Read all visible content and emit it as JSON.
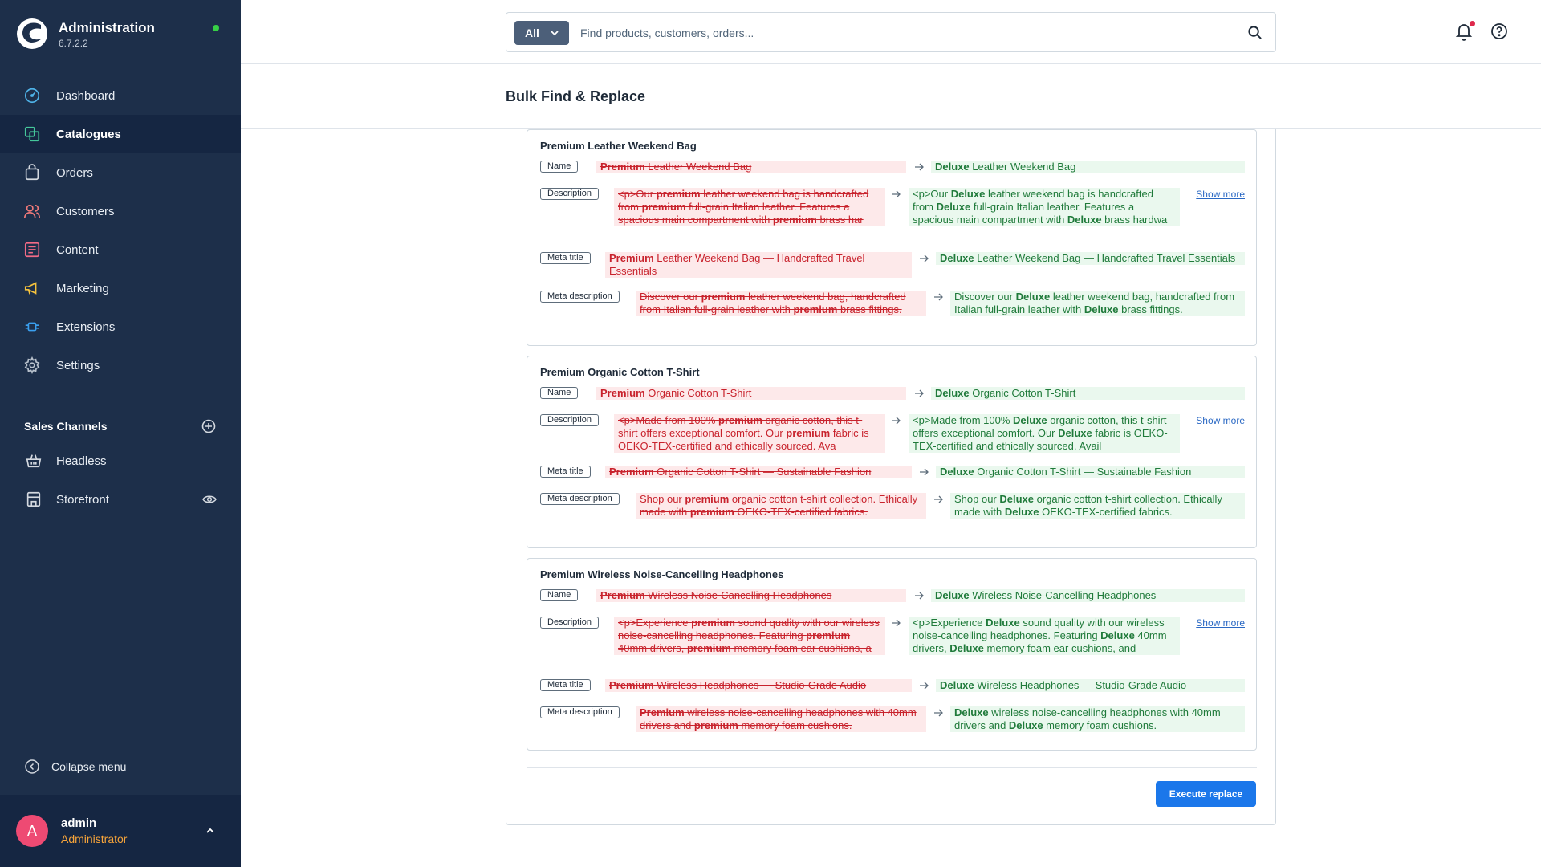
{
  "app": {
    "title": "Administration",
    "version": "6.7.2.2"
  },
  "sidebar": {
    "items": [
      {
        "label": "Dashboard"
      },
      {
        "label": "Catalogues"
      },
      {
        "label": "Orders"
      },
      {
        "label": "Customers"
      },
      {
        "label": "Content"
      },
      {
        "label": "Marketing"
      },
      {
        "label": "Extensions"
      },
      {
        "label": "Settings"
      }
    ],
    "sales_channels_title": "Sales Channels",
    "sales_channels": [
      {
        "label": "Headless"
      },
      {
        "label": "Storefront"
      }
    ],
    "collapse_label": "Collapse menu",
    "user": {
      "initial": "A",
      "name": "admin",
      "role": "Administrator"
    }
  },
  "search": {
    "filter": "All",
    "placeholder": "Find products, customers, orders..."
  },
  "page": {
    "title": "Bulk Find & Replace"
  },
  "groups": [
    {
      "title": "Premium Leather Weekend Bag",
      "rows": [
        {
          "tag": "Name",
          "old_b1": "Premium",
          "old_t1": " Leather Weekend Bag",
          "new_b1": "Deluxe",
          "new_t1": " Leather Weekend Bag"
        },
        {
          "tag": "Description",
          "old_t0": "<p>Our ",
          "old_b1": "premium",
          "old_t1": " leather weekend bag is handcrafted from ",
          "old_b2": "premium",
          "old_t2": " full-grain Italian leather. Features a spacious main compartment with ",
          "old_b3": "premium",
          "old_t3": " brass har",
          "new_t0": "<p>Our ",
          "new_b1": "Deluxe",
          "new_t1": " leather weekend bag is handcrafted from ",
          "new_b2": "Deluxe",
          "new_t2": " full-grain Italian leather. Features a spacious main compartment with ",
          "new_b3": "Deluxe",
          "new_t3": " brass hardwa",
          "show_more": "Show more"
        },
        {
          "tag": "Meta title",
          "old_b1": "Premium",
          "old_t1": " Leather Weekend Bag — Handcrafted Travel Essentials",
          "new_b1": "Deluxe",
          "new_t1": " Leather Weekend Bag — Handcrafted Travel Essentials"
        },
        {
          "tag": "Meta description",
          "old_t0": "Discover our ",
          "old_b1": "premium",
          "old_t1": " leather weekend bag, handcrafted from Italian full-grain leather with ",
          "old_b2": "premium",
          "old_t2": " brass fittings.",
          "new_t0": "Discover our ",
          "new_b1": "Deluxe",
          "new_t1": " leather weekend bag, handcrafted from Italian full-grain leather with ",
          "new_b2": "Deluxe",
          "new_t2": " brass fittings."
        }
      ]
    },
    {
      "title": "Premium Organic Cotton T-Shirt",
      "rows": [
        {
          "tag": "Name",
          "old_b1": "Premium",
          "old_t1": " Organic Cotton T-Shirt",
          "new_b1": "Deluxe",
          "new_t1": " Organic Cotton T-Shirt"
        },
        {
          "tag": "Description",
          "old_t0": "<p>Made from 100% ",
          "old_b1": "premium",
          "old_t1": " organic cotton, this t-shirt offers exceptional comfort. Our ",
          "old_b2": "premium",
          "old_t2": " fabric is OEKO-TEX-certified and ethically sourced. Ava",
          "new_t0": "<p>Made from 100% ",
          "new_b1": "Deluxe",
          "new_t1": " organic cotton, this t-shirt offers exceptional comfort. Our ",
          "new_b2": "Deluxe",
          "new_t2": " fabric is OEKO-TEX-certified and ethically sourced. Avail",
          "show_more": "Show more"
        },
        {
          "tag": "Meta title",
          "old_b1": "Premium",
          "old_t1": " Organic Cotton T-Shirt — Sustainable Fashion",
          "new_b1": "Deluxe",
          "new_t1": " Organic Cotton T-Shirt — Sustainable Fashion"
        },
        {
          "tag": "Meta description",
          "old_t0": "Shop our ",
          "old_b1": "premium",
          "old_t1": " organic cotton t-shirt collection. Ethically made with ",
          "old_b2": "premium",
          "old_t2": " OEKO-TEX-certified fabrics.",
          "new_t0": "Shop our ",
          "new_b1": "Deluxe",
          "new_t1": " organic cotton t-shirt collection. Ethically made with ",
          "new_b2": "Deluxe",
          "new_t2": " OEKO-TEX-certified fabrics."
        }
      ]
    },
    {
      "title": "Premium Wireless Noise-Cancelling Headphones",
      "rows": [
        {
          "tag": "Name",
          "old_b1": "Premium",
          "old_t1": " Wireless Noise-Cancelling Headphones",
          "new_b1": "Deluxe",
          "new_t1": " Wireless Noise-Cancelling Headphones"
        },
        {
          "tag": "Description",
          "old_t0": "<p>Experience ",
          "old_b1": "premium",
          "old_t1": " sound quality with our wireless noise-cancelling headphones. Featuring ",
          "old_b2": "premium",
          "old_t2": " 40mm drivers, ",
          "old_b3": "premium",
          "old_t3": " memory foam ear cushions, a",
          "new_t0": "<p>Experience ",
          "new_b1": "Deluxe",
          "new_t1": " sound quality with our wireless noise-cancelling headphones. Featuring ",
          "new_b2": "Deluxe",
          "new_t2": " 40mm drivers, ",
          "new_b3": "Deluxe",
          "new_t3": " memory foam ear cushions, and",
          "show_more": "Show more"
        },
        {
          "tag": "Meta title",
          "old_b1": "Premium",
          "old_t1": " Wireless Headphones — Studio-Grade Audio",
          "new_b1": "Deluxe",
          "new_t1": " Wireless Headphones — Studio-Grade Audio"
        },
        {
          "tag": "Meta description",
          "old_b1": "Premium",
          "old_t1": " wireless noise-cancelling headphones with 40mm drivers and ",
          "old_b2": "premium",
          "old_t2": " memory foam cushions.",
          "new_b1": "Deluxe",
          "new_t1": " wireless noise-cancelling headphones with 40mm drivers and ",
          "new_b2": "Deluxe",
          "new_t2": " memory foam cushions."
        }
      ]
    }
  ],
  "actions": {
    "execute_label": "Execute replace"
  },
  "colors": {
    "sidebar": "#1d2f4a",
    "primary": "#1b77ea",
    "removed_bg": "#fde9ea",
    "removed_text": "#c8222c",
    "added_bg": "#eaf8ee",
    "added_text": "#1f7a3a"
  }
}
